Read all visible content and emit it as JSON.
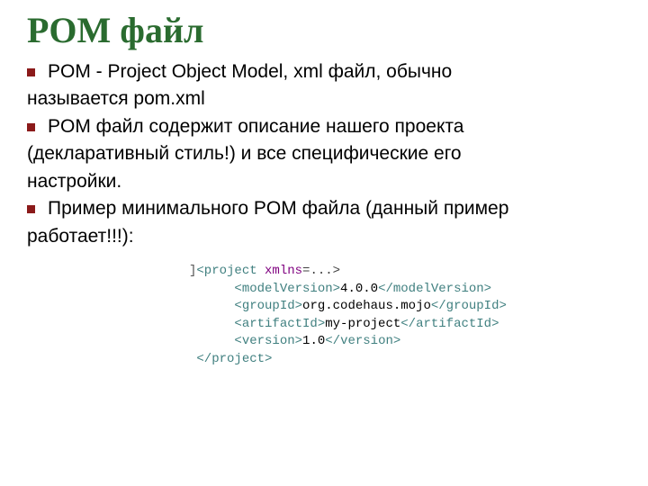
{
  "title": "POM файл",
  "bullets": [
    {
      "lead": "POM - Project Object Model, xml файл, обычно",
      "cont": [
        "называется pom.xml"
      ]
    },
    {
      "lead": "POM файл содержит описание нашего проекта",
      "cont": [
        "(декларативный стиль!) и все специфические его",
        "настройки."
      ]
    },
    {
      "lead": "Пример минимального POM файла (данный пример",
      "cont": [
        "работает!!!):"
      ]
    }
  ],
  "code": {
    "project_open_prefix": "<project ",
    "attr_name": "xmlns",
    "attr_rest": "=...>",
    "modelVersion_open": "<modelVersion>",
    "modelVersion_val": "4.0.0",
    "modelVersion_close": "</modelVersion>",
    "groupId_open": "<groupId>",
    "groupId_val": "org.codehaus.mojo",
    "groupId_close": "</groupId>",
    "artifactId_open": "<artifactId>",
    "artifactId_val": "my-project",
    "artifactId_close": "</artifactId>",
    "version_open": "<version>",
    "version_val": "1.0",
    "version_close": "</version>",
    "project_close": "</project>"
  }
}
